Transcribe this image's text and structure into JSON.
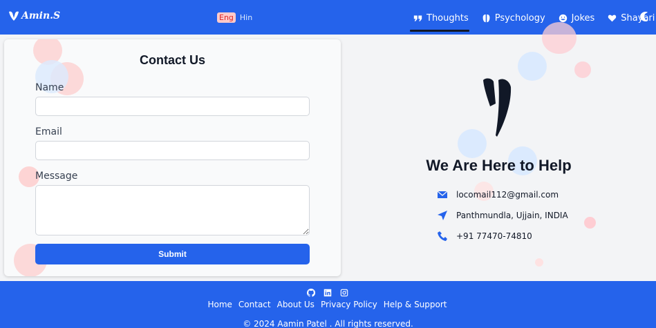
{
  "header": {
    "brand": "Amin.S",
    "lang": {
      "eng": "Eng",
      "hin": "Hin"
    },
    "nav": [
      {
        "label": "Thoughts",
        "icon": "quote-icon",
        "active": true
      },
      {
        "label": "Psychology",
        "icon": "brain-icon",
        "active": false
      },
      {
        "label": "Jokes",
        "icon": "smile-icon",
        "active": false
      },
      {
        "label": "Shayari",
        "icon": "heart-icon",
        "active": false
      }
    ],
    "theme_icon": "moon-icon"
  },
  "contact_form": {
    "title": "Contact Us",
    "name_label": "Name",
    "name_value": "",
    "email_label": "Email",
    "email_value": "",
    "message_label": "Message",
    "message_value": "",
    "submit_label": "Submit"
  },
  "help": {
    "title": "We Are Here to Help",
    "email": "locomail112@gmail.com",
    "address": "Panthmundla, Ujjain, INDIA",
    "phone": "+91 77470-74810"
  },
  "footer": {
    "social_icons": [
      "github-icon",
      "linkedin-icon",
      "instagram-icon"
    ],
    "links": [
      "Home",
      "Contact",
      "About Us",
      "Privacy Policy",
      "Help & Support"
    ],
    "copyright": "© 2024 Aamin Patel . All rights reserved."
  },
  "colors": {
    "primary": "#2563eb",
    "text_dark": "#111827",
    "background": "#f3f4f6"
  }
}
